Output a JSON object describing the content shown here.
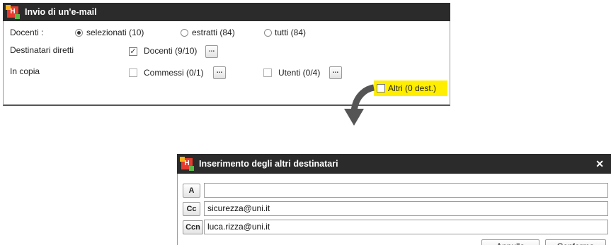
{
  "window1": {
    "title": "Invio di un'e-mail",
    "docenti_label": "Docenti :",
    "radio_options": [
      "selezionati (10)",
      "estratti (84)",
      "tutti (84)"
    ],
    "selected_radio": 0,
    "destinatari_label": "Destinatari diretti",
    "docenti_checkbox": "Docenti (9/10)",
    "in_copia_label": "In copia",
    "commessi_checkbox": "Commessi (0/1)",
    "utenti_checkbox": "Utenti (0/4)",
    "altri_checkbox": "Altri (0 dest.)",
    "more_button": "...",
    "highlight_color": "#ffee00"
  },
  "window2": {
    "title": "Inserimento degli altri destinatari",
    "close_icon": "✕",
    "fields": [
      {
        "label": "A",
        "value": ""
      },
      {
        "label": "Cc",
        "value": "sicurezza@uni.it"
      },
      {
        "label": "Ccn",
        "value": "luca.rizza@uni.it"
      }
    ],
    "cancel_label": "Annulla",
    "confirm_label": "Conferma"
  },
  "colors": {
    "titlebar": "#2b2b2b",
    "arrow": "#555555"
  }
}
